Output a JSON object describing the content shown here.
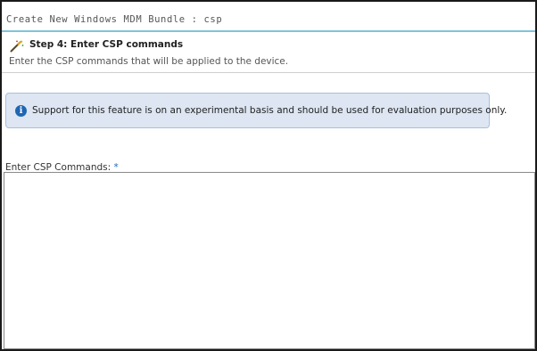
{
  "title": "Create New Windows MDM Bundle : csp",
  "step": {
    "icon": "wand-icon",
    "title": "Step 4: Enter CSP commands",
    "description": "Enter the CSP commands that will be applied to the device."
  },
  "info": {
    "icon": "info-icon",
    "glyph": "i",
    "message": "Support for this feature is on an experimental basis and should be used for evaluation purposes only."
  },
  "csp_field": {
    "label": "Enter CSP Commands:",
    "required_marker": "*",
    "value": ""
  },
  "colors": {
    "title_underline": "#7fc3da",
    "info_background": "#dde6f2",
    "info_border": "#a9bfdc",
    "info_icon": "#1f66b3",
    "required_marker": "#1f66b3"
  }
}
